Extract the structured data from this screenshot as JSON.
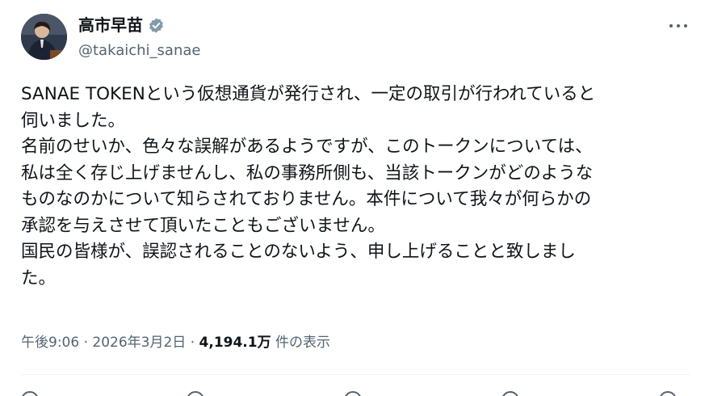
{
  "author": {
    "display_name": "高市早苗",
    "handle": "@takaichi_sanae"
  },
  "post": {
    "lines": [
      "SANAE TOKENという仮想通貨が発行され、一定の取引が行われていると",
      "伺いました。",
      "名前のせいか、色々な誤解があるようですが、このトークンについては、",
      "私は全く存じ上げませんし、私の事務所側も、当該トークンがどのような",
      "ものなのかについて知らされておりません。本件について我々が何らかの",
      "承認を与えさせて頂いたこともございません。",
      "国民の皆様が、誤認されることのないよう、申し上げることと致しまし",
      "た。"
    ]
  },
  "meta": {
    "time": "午後9:06",
    "separator": "·",
    "date": "2026年3月2日",
    "views_count": "4,194.1万",
    "views_label": "件の表示"
  },
  "colors": {
    "text": "#0f1419",
    "muted": "#536471",
    "verified": "#829aab",
    "divider": "#eff3f4"
  },
  "icons": {
    "verified": "verified-badge-icon",
    "more": "more-horizontal-icon"
  }
}
